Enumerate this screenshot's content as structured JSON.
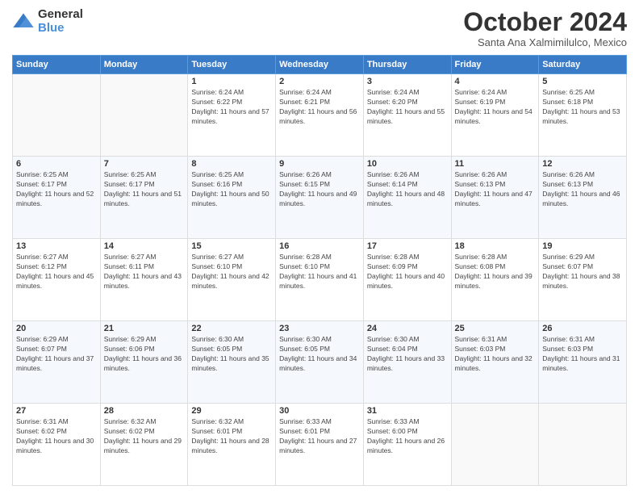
{
  "logo": {
    "general": "General",
    "blue": "Blue"
  },
  "header": {
    "month": "October 2024",
    "location": "Santa Ana Xalmimilulco, Mexico"
  },
  "weekdays": [
    "Sunday",
    "Monday",
    "Tuesday",
    "Wednesday",
    "Thursday",
    "Friday",
    "Saturday"
  ],
  "weeks": [
    [
      {
        "day": "",
        "info": ""
      },
      {
        "day": "",
        "info": ""
      },
      {
        "day": "1",
        "info": "Sunrise: 6:24 AM\nSunset: 6:22 PM\nDaylight: 11 hours and 57 minutes."
      },
      {
        "day": "2",
        "info": "Sunrise: 6:24 AM\nSunset: 6:21 PM\nDaylight: 11 hours and 56 minutes."
      },
      {
        "day": "3",
        "info": "Sunrise: 6:24 AM\nSunset: 6:20 PM\nDaylight: 11 hours and 55 minutes."
      },
      {
        "day": "4",
        "info": "Sunrise: 6:24 AM\nSunset: 6:19 PM\nDaylight: 11 hours and 54 minutes."
      },
      {
        "day": "5",
        "info": "Sunrise: 6:25 AM\nSunset: 6:18 PM\nDaylight: 11 hours and 53 minutes."
      }
    ],
    [
      {
        "day": "6",
        "info": "Sunrise: 6:25 AM\nSunset: 6:17 PM\nDaylight: 11 hours and 52 minutes."
      },
      {
        "day": "7",
        "info": "Sunrise: 6:25 AM\nSunset: 6:17 PM\nDaylight: 11 hours and 51 minutes."
      },
      {
        "day": "8",
        "info": "Sunrise: 6:25 AM\nSunset: 6:16 PM\nDaylight: 11 hours and 50 minutes."
      },
      {
        "day": "9",
        "info": "Sunrise: 6:26 AM\nSunset: 6:15 PM\nDaylight: 11 hours and 49 minutes."
      },
      {
        "day": "10",
        "info": "Sunrise: 6:26 AM\nSunset: 6:14 PM\nDaylight: 11 hours and 48 minutes."
      },
      {
        "day": "11",
        "info": "Sunrise: 6:26 AM\nSunset: 6:13 PM\nDaylight: 11 hours and 47 minutes."
      },
      {
        "day": "12",
        "info": "Sunrise: 6:26 AM\nSunset: 6:13 PM\nDaylight: 11 hours and 46 minutes."
      }
    ],
    [
      {
        "day": "13",
        "info": "Sunrise: 6:27 AM\nSunset: 6:12 PM\nDaylight: 11 hours and 45 minutes."
      },
      {
        "day": "14",
        "info": "Sunrise: 6:27 AM\nSunset: 6:11 PM\nDaylight: 11 hours and 43 minutes."
      },
      {
        "day": "15",
        "info": "Sunrise: 6:27 AM\nSunset: 6:10 PM\nDaylight: 11 hours and 42 minutes."
      },
      {
        "day": "16",
        "info": "Sunrise: 6:28 AM\nSunset: 6:10 PM\nDaylight: 11 hours and 41 minutes."
      },
      {
        "day": "17",
        "info": "Sunrise: 6:28 AM\nSunset: 6:09 PM\nDaylight: 11 hours and 40 minutes."
      },
      {
        "day": "18",
        "info": "Sunrise: 6:28 AM\nSunset: 6:08 PM\nDaylight: 11 hours and 39 minutes."
      },
      {
        "day": "19",
        "info": "Sunrise: 6:29 AM\nSunset: 6:07 PM\nDaylight: 11 hours and 38 minutes."
      }
    ],
    [
      {
        "day": "20",
        "info": "Sunrise: 6:29 AM\nSunset: 6:07 PM\nDaylight: 11 hours and 37 minutes."
      },
      {
        "day": "21",
        "info": "Sunrise: 6:29 AM\nSunset: 6:06 PM\nDaylight: 11 hours and 36 minutes."
      },
      {
        "day": "22",
        "info": "Sunrise: 6:30 AM\nSunset: 6:05 PM\nDaylight: 11 hours and 35 minutes."
      },
      {
        "day": "23",
        "info": "Sunrise: 6:30 AM\nSunset: 6:05 PM\nDaylight: 11 hours and 34 minutes."
      },
      {
        "day": "24",
        "info": "Sunrise: 6:30 AM\nSunset: 6:04 PM\nDaylight: 11 hours and 33 minutes."
      },
      {
        "day": "25",
        "info": "Sunrise: 6:31 AM\nSunset: 6:03 PM\nDaylight: 11 hours and 32 minutes."
      },
      {
        "day": "26",
        "info": "Sunrise: 6:31 AM\nSunset: 6:03 PM\nDaylight: 11 hours and 31 minutes."
      }
    ],
    [
      {
        "day": "27",
        "info": "Sunrise: 6:31 AM\nSunset: 6:02 PM\nDaylight: 11 hours and 30 minutes."
      },
      {
        "day": "28",
        "info": "Sunrise: 6:32 AM\nSunset: 6:02 PM\nDaylight: 11 hours and 29 minutes."
      },
      {
        "day": "29",
        "info": "Sunrise: 6:32 AM\nSunset: 6:01 PM\nDaylight: 11 hours and 28 minutes."
      },
      {
        "day": "30",
        "info": "Sunrise: 6:33 AM\nSunset: 6:01 PM\nDaylight: 11 hours and 27 minutes."
      },
      {
        "day": "31",
        "info": "Sunrise: 6:33 AM\nSunset: 6:00 PM\nDaylight: 11 hours and 26 minutes."
      },
      {
        "day": "",
        "info": ""
      },
      {
        "day": "",
        "info": ""
      }
    ]
  ]
}
